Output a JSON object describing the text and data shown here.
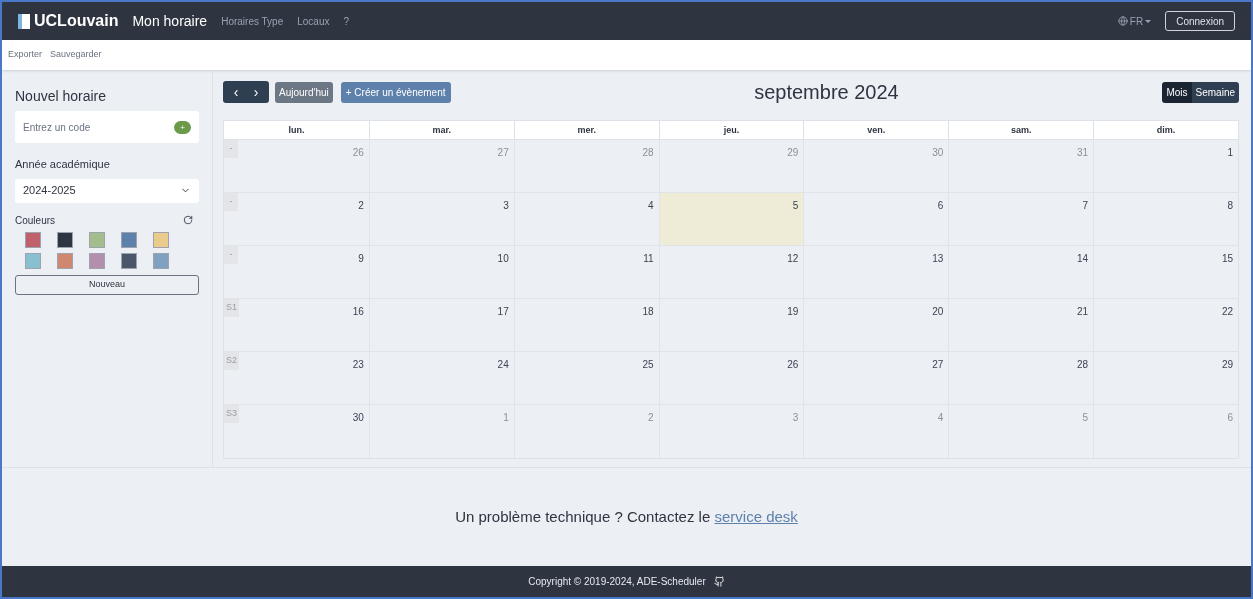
{
  "navbar": {
    "brand": "UCLouvain",
    "links": [
      {
        "label": "Mon horaire",
        "selected": true
      },
      {
        "label": "Horaires Type",
        "selected": false
      },
      {
        "label": "Locaux",
        "selected": false
      },
      {
        "label": "?",
        "selected": false
      }
    ],
    "language": "FR",
    "login": "Connexion"
  },
  "subbar": [
    "Exporter",
    "Sauvegarder"
  ],
  "sidebar": {
    "title": "Nouvel horaire",
    "code_field": {
      "placeholder": "Entrez un code"
    },
    "add_button": "+",
    "year_label": "Année académique",
    "year_select": "2024-2025",
    "colors_label": "Couleurs",
    "colors": [
      {
        "color": "#bf616a"
      },
      {
        "color": "#2e3440"
      },
      {
        "color": "#a3be8c"
      },
      {
        "color": "#5e81ac"
      },
      {
        "color": "#ebcb8b"
      },
      {
        "color": "#88c0d0"
      },
      {
        "color": "#d08770"
      },
      {
        "color": "#b48ead"
      },
      {
        "color": "#4c566a"
      },
      {
        "color": "#81a1c1"
      }
    ],
    "new_button": "Nouveau"
  },
  "calendar": {
    "prev": "‹",
    "next": "›",
    "today_button": "Aujourd'hui",
    "create_button": "+ Créer un évènement",
    "title": "septembre 2024",
    "views": [
      {
        "label": "Mois",
        "selected": true
      },
      {
        "label": "Semaine",
        "selected": false
      }
    ],
    "columns": [
      "lun.",
      "mar.",
      "mer.",
      "jeu.",
      "ven.",
      "sam.",
      "dim."
    ],
    "weeks": [
      {
        "label": "-",
        "days": [
          {
            "date": "26",
            "muted": true,
            "today": false
          },
          {
            "date": "27",
            "muted": true,
            "today": false
          },
          {
            "date": "28",
            "muted": true,
            "today": false
          },
          {
            "date": "29",
            "muted": true,
            "today": false
          },
          {
            "date": "30",
            "muted": true,
            "today": false
          },
          {
            "date": "31",
            "muted": true,
            "today": false
          },
          {
            "date": "1",
            "muted": false,
            "today": false
          }
        ]
      },
      {
        "label": "-",
        "days": [
          {
            "date": "2",
            "muted": false,
            "today": false
          },
          {
            "date": "3",
            "muted": false,
            "today": false
          },
          {
            "date": "4",
            "muted": false,
            "today": false
          },
          {
            "date": "5",
            "muted": false,
            "today": true
          },
          {
            "date": "6",
            "muted": false,
            "today": false
          },
          {
            "date": "7",
            "muted": false,
            "today": false
          },
          {
            "date": "8",
            "muted": false,
            "today": false
          }
        ]
      },
      {
        "label": "-",
        "days": [
          {
            "date": "9",
            "muted": false,
            "today": false
          },
          {
            "date": "10",
            "muted": false,
            "today": false
          },
          {
            "date": "11",
            "muted": false,
            "today": false
          },
          {
            "date": "12",
            "muted": false,
            "today": false
          },
          {
            "date": "13",
            "muted": false,
            "today": false
          },
          {
            "date": "14",
            "muted": false,
            "today": false
          },
          {
            "date": "15",
            "muted": false,
            "today": false
          }
        ]
      },
      {
        "label": "S1",
        "days": [
          {
            "date": "16",
            "muted": false,
            "today": false
          },
          {
            "date": "17",
            "muted": false,
            "today": false
          },
          {
            "date": "18",
            "muted": false,
            "today": false
          },
          {
            "date": "19",
            "muted": false,
            "today": false
          },
          {
            "date": "20",
            "muted": false,
            "today": false
          },
          {
            "date": "21",
            "muted": false,
            "today": false
          },
          {
            "date": "22",
            "muted": false,
            "today": false
          }
        ]
      },
      {
        "label": "S2",
        "days": [
          {
            "date": "23",
            "muted": false,
            "today": false
          },
          {
            "date": "24",
            "muted": false,
            "today": false
          },
          {
            "date": "25",
            "muted": false,
            "today": false
          },
          {
            "date": "26",
            "muted": false,
            "today": false
          },
          {
            "date": "27",
            "muted": false,
            "today": false
          },
          {
            "date": "28",
            "muted": false,
            "today": false
          },
          {
            "date": "29",
            "muted": false,
            "today": false
          }
        ]
      },
      {
        "label": "S3",
        "days": [
          {
            "date": "30",
            "muted": false,
            "today": false
          },
          {
            "date": "1",
            "muted": true,
            "today": false
          },
          {
            "date": "2",
            "muted": true,
            "today": false
          },
          {
            "date": "3",
            "muted": true,
            "today": false
          },
          {
            "date": "4",
            "muted": true,
            "today": false
          },
          {
            "date": "5",
            "muted": true,
            "today": false
          },
          {
            "date": "6",
            "muted": true,
            "today": false
          }
        ]
      }
    ]
  },
  "help": {
    "text": "Un problème technique ? Contactez le",
    "link": "service desk"
  },
  "footer": {
    "text": "Copyright © 2019-2024, ADE-Scheduler"
  }
}
